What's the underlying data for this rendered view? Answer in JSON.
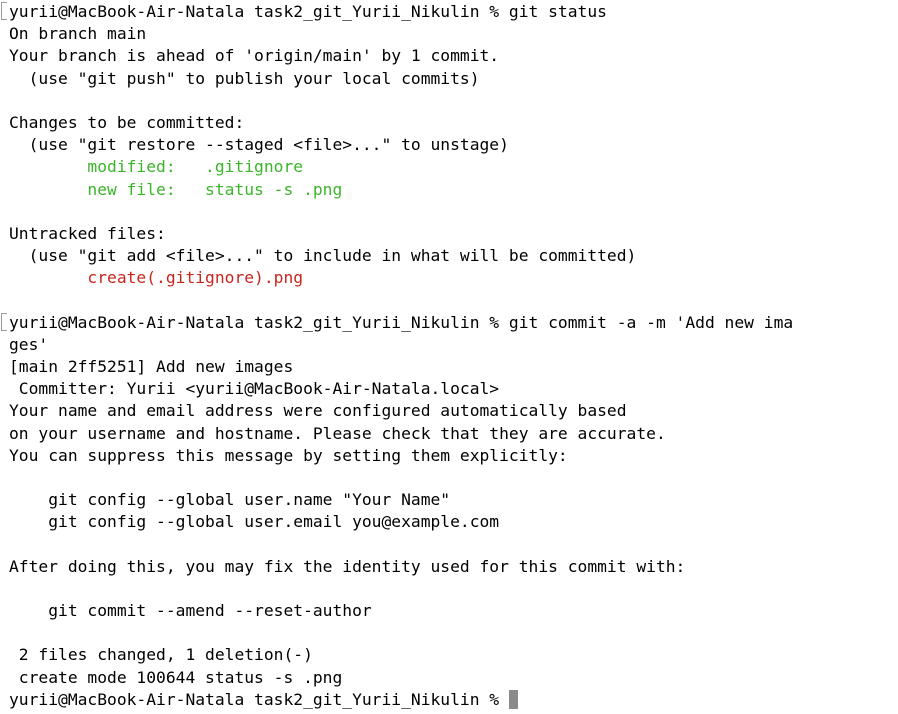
{
  "terminal": {
    "lines": [
      {
        "text": "yurii@MacBook-Air-Natala task2_git_Yurii_Nikulin % git status",
        "style": "normal",
        "mark": true
      },
      {
        "text": "On branch main",
        "style": "normal"
      },
      {
        "text": "Your branch is ahead of 'origin/main' by 1 commit.",
        "style": "normal"
      },
      {
        "text": "  (use \"git push\" to publish your local commits)",
        "style": "normal"
      },
      {
        "text": "",
        "style": "normal"
      },
      {
        "text": "Changes to be committed:",
        "style": "normal"
      },
      {
        "text": "  (use \"git restore --staged <file>...\" to unstage)",
        "style": "normal"
      },
      {
        "text": "        modified:   .gitignore",
        "style": "green"
      },
      {
        "text": "        new file:   status -s .png",
        "style": "green"
      },
      {
        "text": "",
        "style": "normal"
      },
      {
        "text": "Untracked files:",
        "style": "normal"
      },
      {
        "text": "  (use \"git add <file>...\" to include in what will be committed)",
        "style": "normal"
      },
      {
        "text": "        create(.gitignore).png",
        "style": "red"
      },
      {
        "text": "",
        "style": "normal"
      },
      {
        "text": "yurii@MacBook-Air-Natala task2_git_Yurii_Nikulin % git commit -a -m 'Add new ima",
        "style": "normal",
        "mark": true
      },
      {
        "text": "ges'",
        "style": "normal"
      },
      {
        "text": "[main 2ff5251] Add new images",
        "style": "normal"
      },
      {
        "text": " Committer: Yurii <yurii@MacBook-Air-Natala.local>",
        "style": "normal"
      },
      {
        "text": "Your name and email address were configured automatically based",
        "style": "normal"
      },
      {
        "text": "on your username and hostname. Please check that they are accurate.",
        "style": "normal"
      },
      {
        "text": "You can suppress this message by setting them explicitly:",
        "style": "normal"
      },
      {
        "text": "",
        "style": "normal"
      },
      {
        "text": "    git config --global user.name \"Your Name\"",
        "style": "normal"
      },
      {
        "text": "    git config --global user.email you@example.com",
        "style": "normal"
      },
      {
        "text": "",
        "style": "normal"
      },
      {
        "text": "After doing this, you may fix the identity used for this commit with:",
        "style": "normal"
      },
      {
        "text": "",
        "style": "normal"
      },
      {
        "text": "    git commit --amend --reset-author",
        "style": "normal"
      },
      {
        "text": "",
        "style": "normal"
      },
      {
        "text": " 2 files changed, 1 deletion(-)",
        "style": "normal"
      },
      {
        "text": " create mode 100644 status -s .png",
        "style": "normal"
      },
      {
        "text": "yurii@MacBook-Air-Natala task2_git_Yurii_Nikulin % ",
        "style": "normal",
        "cursor": true
      }
    ],
    "colors": {
      "background": "#ffffff",
      "text": "#000000",
      "staged": "#3bb52a",
      "untracked": "#c8261d",
      "cursor": "#8a8a8a"
    },
    "cursor_icon": "block-cursor"
  }
}
